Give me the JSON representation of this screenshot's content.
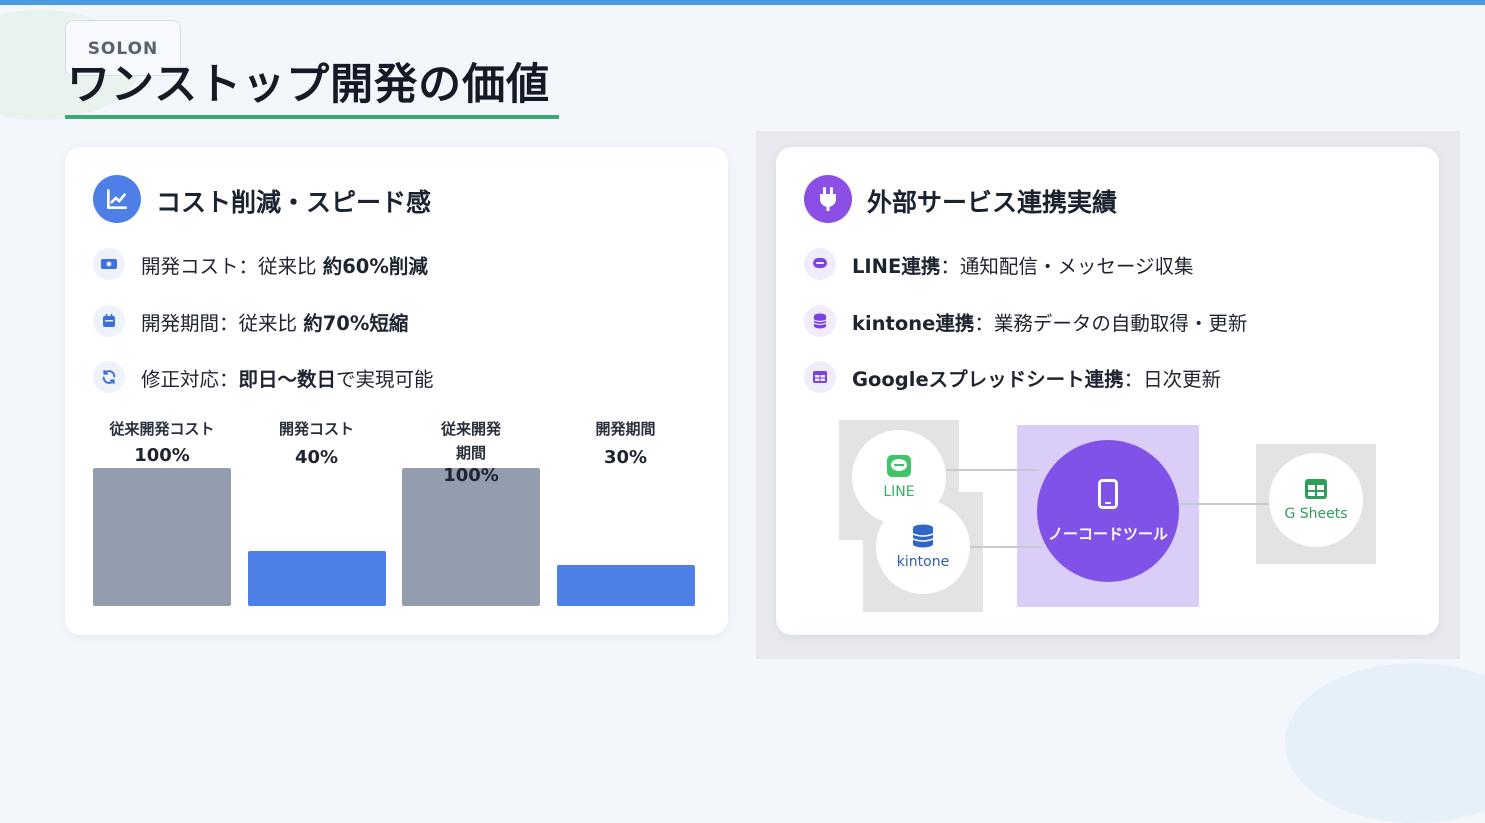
{
  "brand": {
    "logo_text": "SOLON"
  },
  "page": {
    "title": "ワンストップ開発の価値"
  },
  "colors": {
    "accent_green": "#3aa875",
    "blue": "#4d7fe6",
    "purple": "#8b4fe6",
    "gray_bar": "#949dae"
  },
  "left_card": {
    "title": "コスト削減・スピード感",
    "icon": "chart-line-icon",
    "items": [
      {
        "icon": "money-icon",
        "label": "開発コスト：従来比 ",
        "emphasis": "約60%削減",
        "suffix": ""
      },
      {
        "icon": "calendar-icon",
        "label": "開発期間：従来比 ",
        "emphasis": "約70%短縮",
        "suffix": ""
      },
      {
        "icon": "refresh-icon",
        "label": "修正対応：",
        "emphasis": "即日〜数日",
        "suffix": "で実現可能"
      }
    ]
  },
  "chart_data": {
    "type": "bar",
    "categories": [
      "従来開発コスト",
      "開発コスト",
      "従来開発期間",
      "開発期間"
    ],
    "values": [
      100,
      40,
      100,
      30
    ],
    "value_labels": [
      "100%",
      "40%",
      "100%",
      "30%"
    ],
    "colors": [
      "#949dae",
      "#4d7fe6",
      "#949dae",
      "#4d7fe6"
    ],
    "ylim": [
      0,
      100
    ]
  },
  "right_card": {
    "title": "外部サービス連携実績",
    "icon": "plug-icon",
    "items": [
      {
        "icon": "chat-icon",
        "emphasis": "LINE連携",
        "label": "：通知配信・メッセージ収集"
      },
      {
        "icon": "database-icon",
        "emphasis": "kintone連携",
        "label": "：業務データの自動取得・更新"
      },
      {
        "icon": "table-icon",
        "emphasis": "Googleスプレッドシート連携",
        "label": "：日次更新"
      }
    ]
  },
  "diagram": {
    "nodes": {
      "line": "LINE",
      "kintone": "kintone",
      "center": "ノーコードツール",
      "sheets": "G Sheets"
    }
  }
}
